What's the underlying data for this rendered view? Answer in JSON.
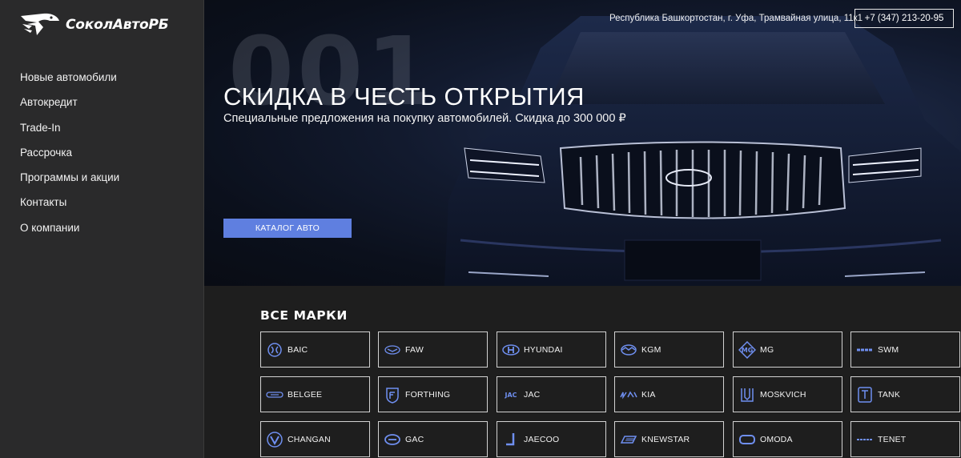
{
  "brand": {
    "name": "СоколАвтоРБ",
    "accent": "#5f7fe0"
  },
  "nav": [
    "Новые автомобили",
    "Автокредит",
    "Trade-In",
    "Рассрочка",
    "Программы и акции",
    "Контакты",
    "О компании"
  ],
  "header": {
    "address": "Республика Башкортостан, г. Уфа, Трамвайная улица, 11к1",
    "phone": "+7 (347) 213-20-95"
  },
  "hero": {
    "slide_number": "001",
    "title": "СКИДКА В ЧЕСТЬ ОТКРЫТИЯ",
    "subtitle": "Специальные предложения на покупку автомобилей. Скидка до 300 000 ₽",
    "cta_label": "КАТАЛОГ АВТО"
  },
  "brands": {
    "title": "ВСЕ МАРКИ",
    "items": [
      {
        "name": "BAIC",
        "icon": "baic-logo"
      },
      {
        "name": "FAW",
        "icon": "faw-logo"
      },
      {
        "name": "HYUNDAI",
        "icon": "hyundai-logo"
      },
      {
        "name": "KGM",
        "icon": "kgm-logo"
      },
      {
        "name": "MG",
        "icon": "mg-logo"
      },
      {
        "name": "SWM",
        "icon": "swm-logo"
      },
      {
        "name": "BELGEE",
        "icon": "belgee-logo"
      },
      {
        "name": "FORTHING",
        "icon": "forthing-logo"
      },
      {
        "name": "JAC",
        "icon": "jac-logo"
      },
      {
        "name": "KIA",
        "icon": "kia-logo"
      },
      {
        "name": "MOSKVICH",
        "icon": "moskvich-logo"
      },
      {
        "name": "TANK",
        "icon": "tank-logo"
      },
      {
        "name": "CHANGAN",
        "icon": "changan-logo"
      },
      {
        "name": "GAC",
        "icon": "gac-logo"
      },
      {
        "name": "JAECOO",
        "icon": "jaecoo-logo"
      },
      {
        "name": "KNEWSTAR",
        "icon": "knewstar-logo"
      },
      {
        "name": "OMODA",
        "icon": "omoda-logo"
      },
      {
        "name": "TENET",
        "icon": "tenet-logo"
      }
    ]
  }
}
